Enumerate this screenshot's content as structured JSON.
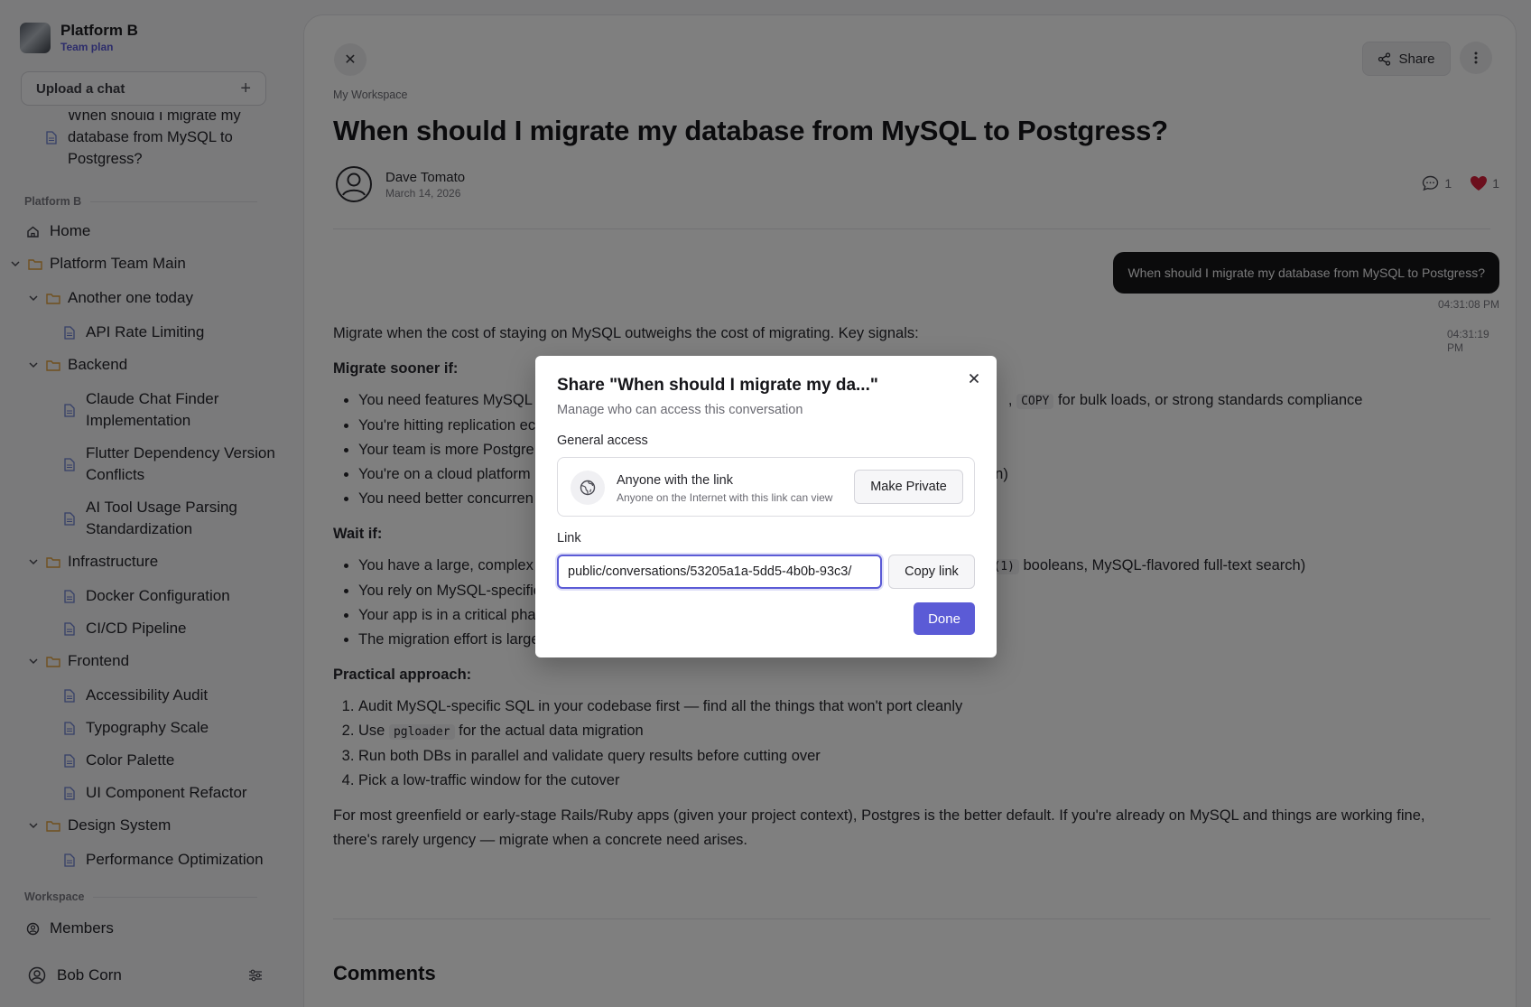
{
  "sidebar": {
    "org_name": "Platform B",
    "plan": "Team plan",
    "upload_label": "Upload a chat",
    "recent_chat": [
      "When should I migrate my",
      "database from MySQL to",
      "Postgress?"
    ],
    "section_org": "Platform B",
    "home": "Home",
    "team_folder": "Platform Team Main",
    "folder_another": "Another one today",
    "doc_api": "API Rate Limiting",
    "folder_backend": "Backend",
    "doc_claude": [
      "Claude Chat Finder",
      "Implementation"
    ],
    "doc_flutter": [
      "Flutter Dependency Version",
      "Conflicts"
    ],
    "doc_ai": [
      "AI Tool Usage Parsing",
      "Standardization"
    ],
    "folder_infra": "Infrastructure",
    "doc_docker": "Docker Configuration",
    "doc_cicd": "CI/CD Pipeline",
    "folder_frontend": "Frontend",
    "doc_a11y": "Accessibility Audit",
    "doc_typo": "Typography Scale",
    "doc_color": "Color Palette",
    "doc_uicomp": "UI Component Refactor",
    "folder_design": "Design System",
    "doc_perf": "Performance Optimization",
    "section_workspace": "Workspace",
    "members": "Members",
    "user": "Bob Corn"
  },
  "main": {
    "share_label": "Share",
    "breadcrumb": "My Workspace",
    "title": "When should I migrate my database from MySQL to Postgress?",
    "author": "Dave Tomato",
    "date": "March 14, 2026",
    "comment_count": "1",
    "like_count": "1",
    "user_message": "When should I migrate my database from MySQL to Postgress?",
    "user_time": "04:31:08 PM",
    "ai_time": "04:31:19 PM",
    "answer": {
      "intro": "Migrate when the cost of staying on MySQL outweighs the cost of migrating. Key signals:",
      "sooner_heading": "Migrate sooner if:",
      "sooner_1a": "You need features MySQL ",
      "sooner_1b": ", ",
      "sooner_1_code": "COPY",
      "sooner_1c": " for bulk loads, or strong standards compliance",
      "sooner_2": "You're hitting replication ec",
      "sooner_3": "Your team is more Postgre",
      "sooner_4a": "You're on a cloud platform ",
      "sooner_4b": "n)",
      "sooner_5": "You need better concurren",
      "wait_heading": "Wait if:",
      "wait_1a": "You have a large, complex ",
      "wait_1_code": "(1)",
      "wait_1b": " booleans, MySQL-flavored full-text search)",
      "wait_2": "You rely on MySQL-specific",
      "wait_3": "Your app is in a critical pha",
      "wait_4": "The migration effort is large relative to the benefit",
      "practical_heading": "Practical approach:",
      "step_1": "Audit MySQL-specific SQL in your codebase first — find all the things that won't port cleanly",
      "step_2a": "Use ",
      "step_2_code": "pgloader",
      "step_2b": " for the actual data migration",
      "step_3": "Run both DBs in parallel and validate query results before cutting over",
      "step_4": "Pick a low-traffic window for the cutover",
      "conclusion": "For most greenfield or early-stage Rails/Ruby apps (given your project context), Postgres is the better default. If you're already on MySQL and things are working fine, there's rarely urgency — migrate when a concrete need arises."
    },
    "comments_heading": "Comments"
  },
  "modal": {
    "title": "Share \"When should I migrate my da...\"",
    "subtitle": "Manage who can access this conversation",
    "general_access_label": "General access",
    "access_title": "Anyone with the link",
    "access_subtitle": "Anyone on the Internet with this link can view",
    "make_private_label": "Make Private",
    "link_label": "Link",
    "link_value": "/public/conversations/53205a1a-5dd5-4b0b-93c3",
    "copy_label": "Copy link",
    "done_label": "Done"
  },
  "colors": {
    "accent": "#5b5bd6",
    "like": "#d91e3a",
    "folder": "#e0a13c",
    "doc": "#6b7fd1"
  }
}
